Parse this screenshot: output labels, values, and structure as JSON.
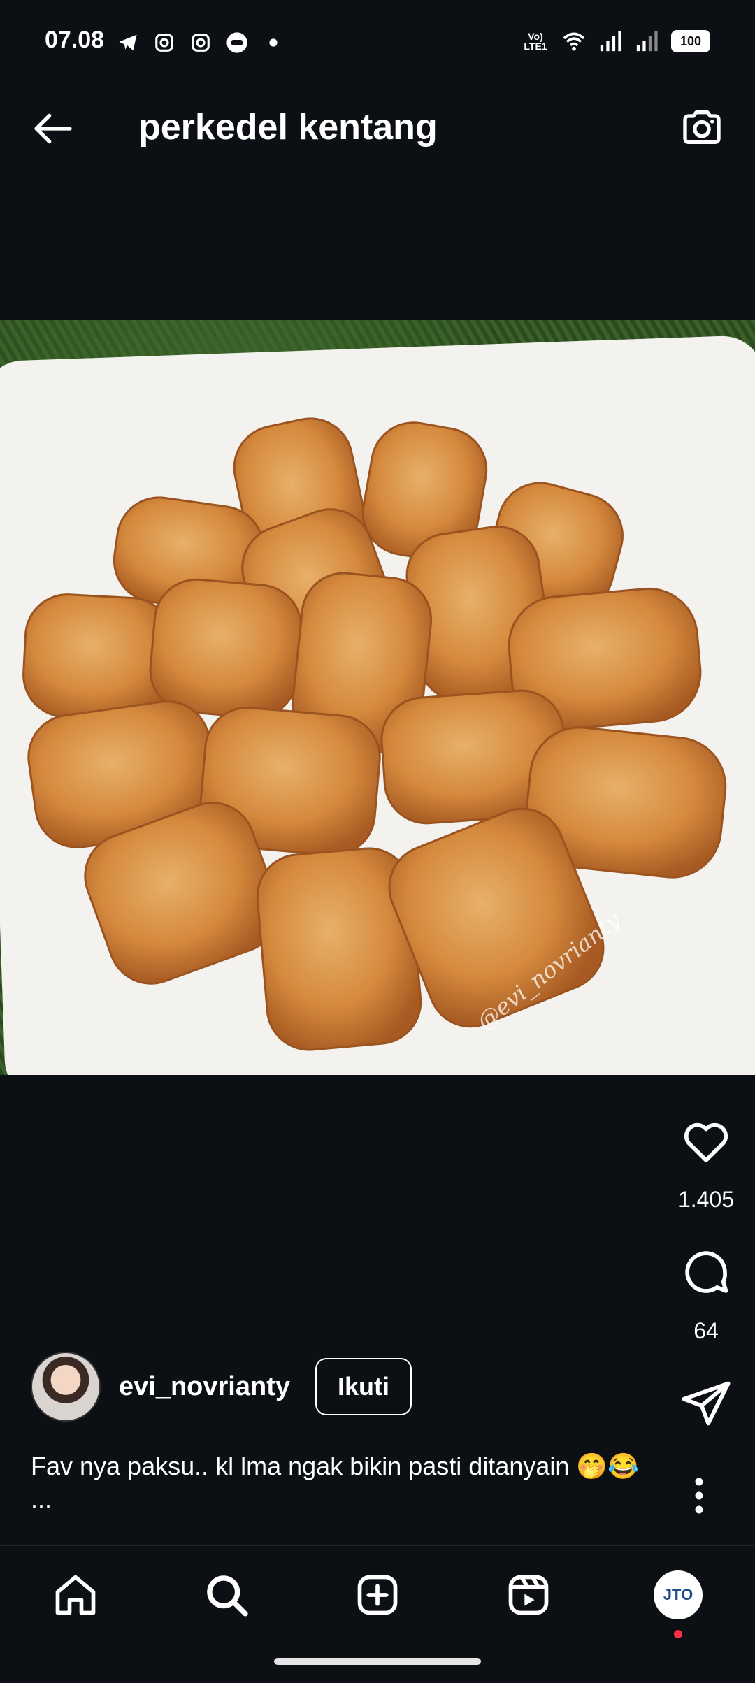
{
  "status_bar": {
    "time": "07.08",
    "battery": "100",
    "network": "Vo) LTE1"
  },
  "header": {
    "title": "perkedel kentang"
  },
  "post": {
    "watermark": "@evi_novrianty",
    "likes": "1.405",
    "comments": "64",
    "author": {
      "username": "evi_novrianty",
      "follow_label": "Ikuti"
    },
    "caption": "Fav nya paksu.. kl lma ngak bikin pasti ditanyain 🤭😂 ..."
  },
  "bottom_nav": {
    "items": [
      "home-icon",
      "search-icon",
      "create-icon",
      "reels-icon",
      "profile-avatar"
    ],
    "profile_logo": "JTO"
  },
  "colors": {
    "background": "#0c1014",
    "notification": "#ff3040"
  }
}
